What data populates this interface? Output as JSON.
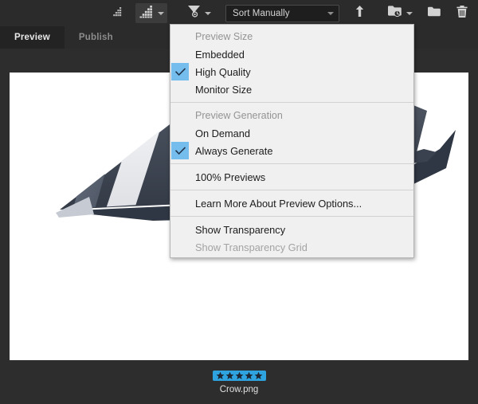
{
  "toolbar": {
    "thumbnail_small_icon": "thumbnail-size-small-icon",
    "thumbnail_large_icon": "thumbnail-size-large-icon",
    "filter_icon": "filter-funnel-icon",
    "sort": {
      "value": "Sort Manually",
      "chevron_icon": "chevron-down-icon"
    },
    "sort_direction_icon": "sort-ascending-arrow-icon",
    "new_folder_recent_icon": "recent-folder-icon",
    "new_folder_icon": "new-folder-icon",
    "delete_icon": "trash-icon"
  },
  "tabs": [
    {
      "label": "Preview",
      "active": true
    },
    {
      "label": "Publish",
      "active": false
    }
  ],
  "menu": {
    "sections": [
      {
        "header": "Preview Size",
        "items": [
          {
            "label": "Embedded",
            "checked": false,
            "disabled": false
          },
          {
            "label": "High Quality",
            "checked": true,
            "disabled": false
          },
          {
            "label": "Monitor Size",
            "checked": false,
            "disabled": false
          }
        ]
      },
      {
        "header": "Preview Generation",
        "items": [
          {
            "label": "On Demand",
            "checked": false,
            "disabled": false
          },
          {
            "label": "Always Generate",
            "checked": true,
            "disabled": false
          }
        ]
      },
      {
        "header": null,
        "items": [
          {
            "label": "100% Previews",
            "checked": false,
            "disabled": false
          }
        ]
      },
      {
        "header": null,
        "items": [
          {
            "label": "Learn More About Preview Options...",
            "checked": false,
            "disabled": false
          }
        ]
      },
      {
        "header": null,
        "items": [
          {
            "label": "Show Transparency",
            "checked": false,
            "disabled": false
          },
          {
            "label": "Show Transparency Grid",
            "checked": false,
            "disabled": true
          }
        ]
      }
    ],
    "check_icon": "checkmark-icon"
  },
  "item": {
    "filename": "Crow.png",
    "rating": 5,
    "rating_max": 5,
    "rating_badge_color": "#2ea3e0",
    "star_icon": "star-icon",
    "artwork_alt": "crow-illustration"
  },
  "colors": {
    "toolbar_bg": "#2b2b2b",
    "panel_bg": "#2d2d2d",
    "active_tab_bg": "#232323",
    "menu_bg": "#f0f0f0",
    "check_highlight": "#74bdec",
    "accent_blue": "#2ea3e0"
  }
}
